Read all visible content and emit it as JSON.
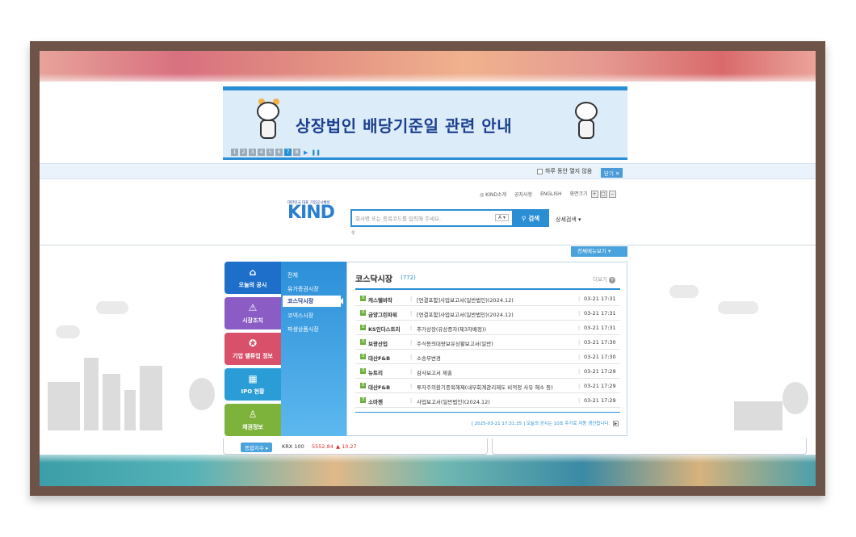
{
  "banner": {
    "title": "상장법인 배당기준일 관련 안내",
    "pages": [
      "1",
      "2",
      "3",
      "4",
      "5",
      "6",
      "7",
      "8"
    ],
    "active_page": "7"
  },
  "popup": {
    "checkbox_label": "하루 동안 열지 않음",
    "close_label": "닫기"
  },
  "utility": {
    "kind_intro": "KIND소개",
    "notice": "공지사항",
    "english": "ENGLISH",
    "font_size": "화면크기"
  },
  "logo": {
    "tagline": "대한민국 대표 기업공시채널",
    "word": "KIND"
  },
  "search": {
    "placeholder": "회사명 또는 종목코드를 입력해 주세요.",
    "select_value": "A",
    "button_label": "검색",
    "advanced_label": "상세검색"
  },
  "all_menu_label": "전체메뉴보기",
  "left_nav": [
    {
      "label": "오늘의 공시",
      "icon": "building-icon",
      "color": "#1d6fc9"
    },
    {
      "label": "시장조치",
      "icon": "warning-icon",
      "color": "#8a5cc4"
    },
    {
      "label": "기업 밸류업 정보",
      "icon": "medal-icon",
      "color": "#d9506a"
    },
    {
      "label": "IPO 현황",
      "icon": "tower-icon",
      "color": "#2a9dd6"
    },
    {
      "label": "채권정보",
      "icon": "stamp-icon",
      "color": "#7db33b"
    }
  ],
  "sub_menu": [
    "전체",
    "유가증권시장",
    "코스닥시장",
    "코넥스시장",
    "파생상품시장"
  ],
  "sub_menu_active": "코스닥시장",
  "content": {
    "title": "코스닥시장",
    "count": "(772)",
    "more_label": "더보기",
    "rows": [
      {
        "company": "캐스텔바작",
        "doc": "[연결포함]사업보고서(일반법인)(2024.12)",
        "time": "03-21 17:31"
      },
      {
        "company": "금양그린파워",
        "doc": "[연결포함]사업보고서(일반법인)(2024.12)",
        "time": "03-21 17:31"
      },
      {
        "company": "KS인더스트리",
        "doc": "추가상장(유상증자(제3자배정))",
        "time": "03-21 17:31"
      },
      {
        "company": "보광산업",
        "doc": "주식등의대량보유상황보고서(일반)",
        "time": "03-21 17:30"
      },
      {
        "company": "대산F&B",
        "doc": "소송부변경",
        "time": "03-21 17:30"
      },
      {
        "company": "뉴트리",
        "doc": "감사보고서 제출",
        "time": "03-21 17:29"
      },
      {
        "company": "대산F&B",
        "doc": "투자주의환기종목해제(내부회계관리제도 비적정 사유 해소 등)",
        "time": "03-21 17:29"
      },
      {
        "company": "소마젠",
        "doc": "사업보고서(일반법인)(2024.12)",
        "time": "03-21 17:29"
      }
    ],
    "footer": "[ 2025-03-21 17:31:35 ] 오늘의 공시는 10초 주기로 자동 갱신됩니다."
  },
  "ticker": {
    "label": "종합지수",
    "index_name": "KRX 100",
    "value": "5552.84",
    "change": "▲ 10.27"
  }
}
